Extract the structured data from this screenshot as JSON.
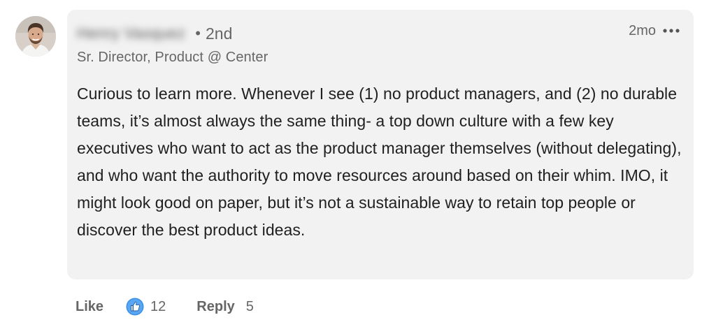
{
  "comment": {
    "author_name": "Henry Vasquez",
    "degree_separator": "•",
    "degree": "2nd",
    "headline": "Sr. Director, Product @ Center",
    "time": "2mo",
    "more_icon": "more-horizontal-icon",
    "body": "Curious to learn more. Whenever I see (1) no product managers, and (2) no durable teams, it’s almost always the same thing- a top down culture with a few key executives who want to act as the product manager themselves (without delegating), and who want the authority to move resources around based on their whim. IMO, it might look good on paper, but it’s not a sustainable way to retain top people or discover the best product ideas."
  },
  "actions": {
    "like_label": "Like",
    "reaction_icon": "thumbs-up-icon",
    "reaction_count": "12",
    "reply_label": "Reply",
    "reply_count": "5"
  },
  "colors": {
    "bubble_bg": "#f2f2f2",
    "secondary_text": "#666666",
    "like_blue": "#378fe9"
  }
}
